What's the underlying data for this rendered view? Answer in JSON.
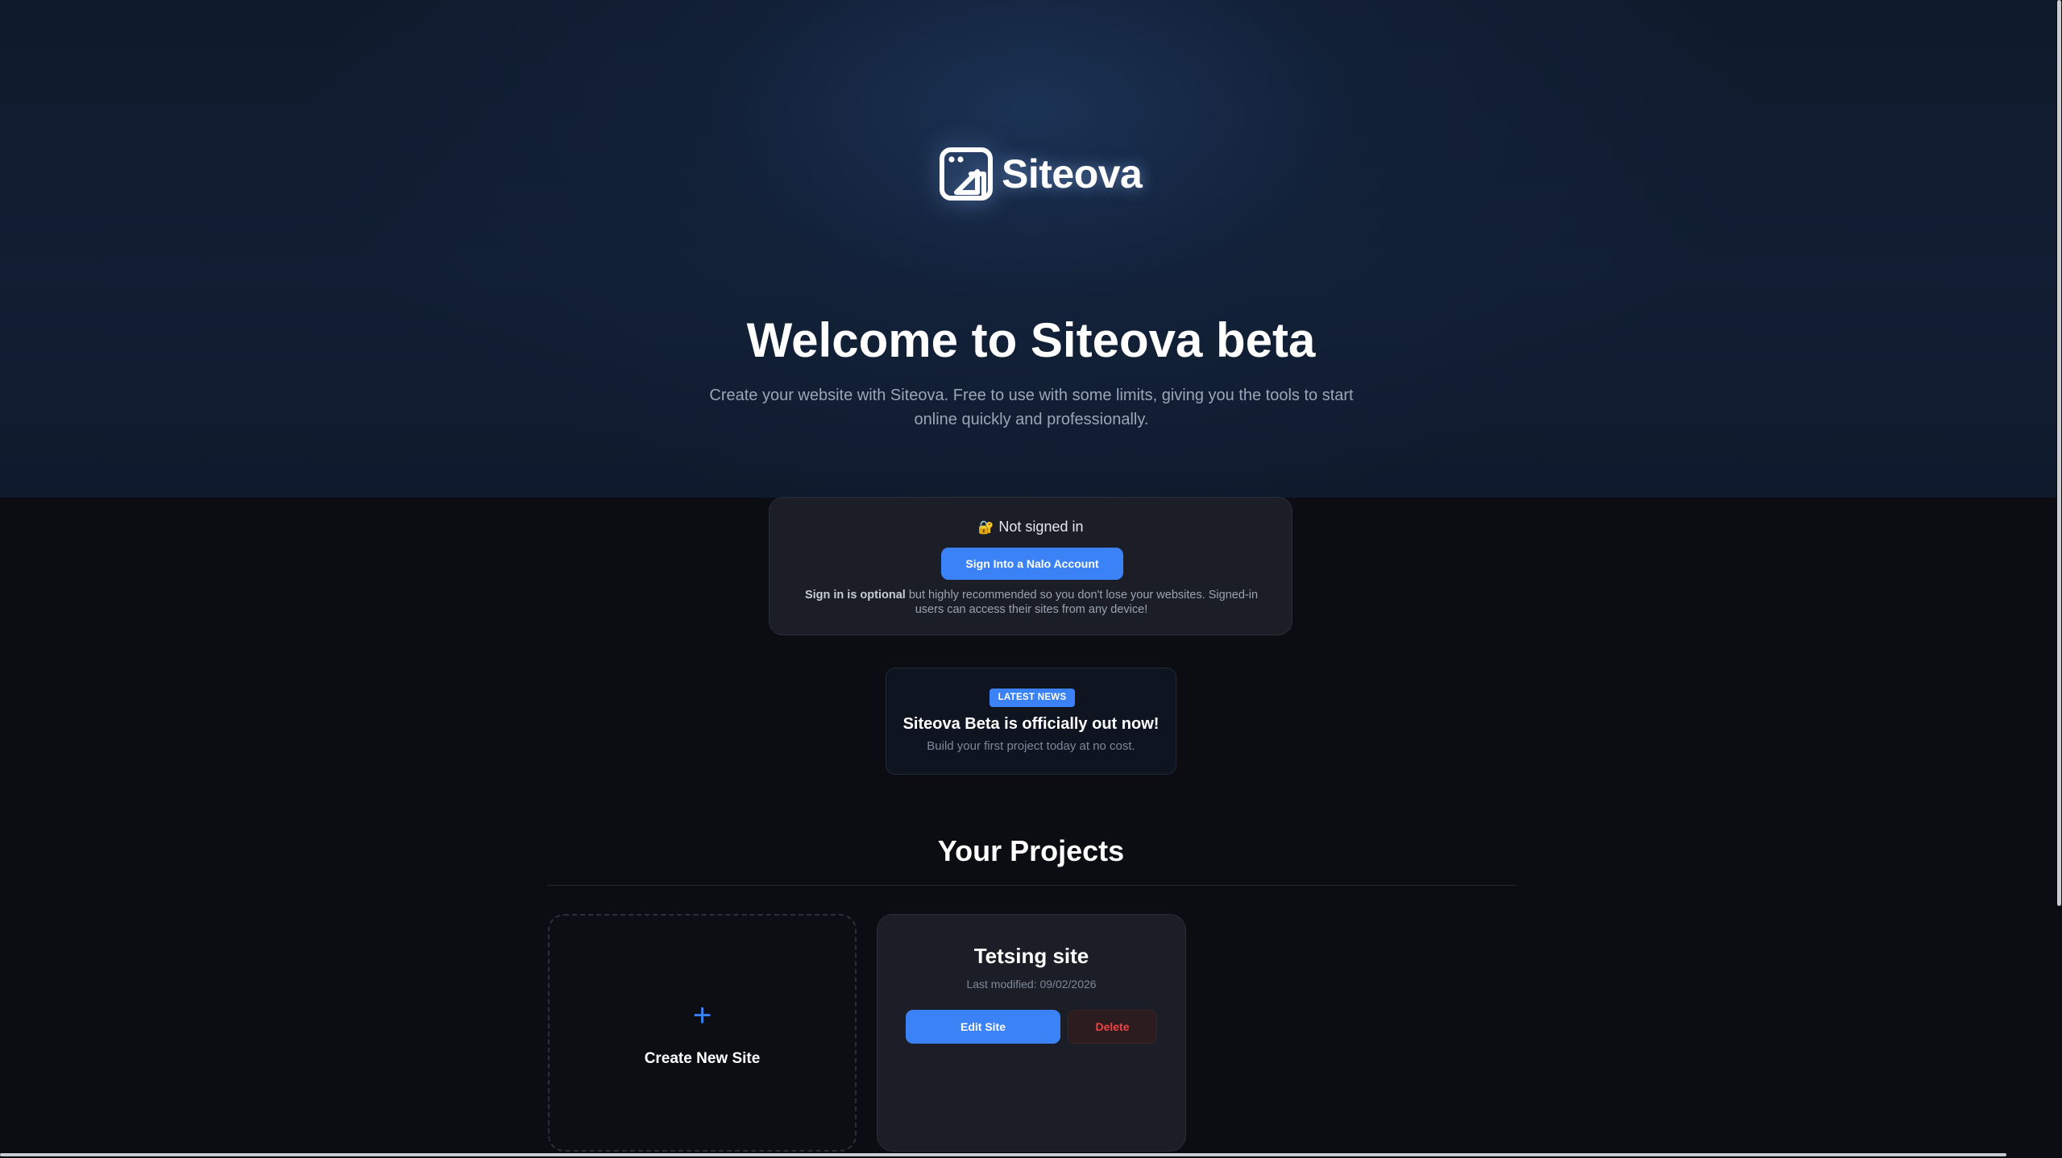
{
  "brand": {
    "name": "Siteova",
    "logo_icon": "browser-window-icon"
  },
  "hero": {
    "title": "Welcome to Siteova beta",
    "subtitle": "Create your website with Siteova. Free to use with some limits, giving you the tools to start online quickly and professionally."
  },
  "signin": {
    "status_icon": "lock-icon",
    "status_text": "Not signed in",
    "button_label": "Sign Into a Nalo Account",
    "note_bold": "Sign in is optional",
    "note_rest": " but highly recommended so you don't lose your websites. Signed-in users can access their sites from any device!"
  },
  "news": {
    "badge": "LATEST NEWS",
    "title": "Siteova Beta is officially out now!",
    "subtitle": "Build your first project today at no cost."
  },
  "projects": {
    "title": "Your Projects",
    "create_label": "Create New Site",
    "create_icon": "+",
    "items": [
      {
        "name": "Tetsing site",
        "modified": "Last modified: 09/02/2026",
        "edit_label": "Edit Site",
        "delete_label": "Delete"
      }
    ]
  },
  "colors": {
    "accent": "#3b82f6",
    "danger": "#ef4444",
    "background": "#0b0d12",
    "card": "#1b1e26"
  }
}
